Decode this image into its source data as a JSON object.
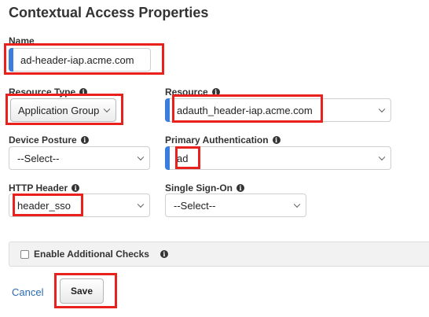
{
  "title": "Contextual Access Properties",
  "name_field": {
    "label": "Name",
    "value": "ad-header-iap.acme.com"
  },
  "resource_type": {
    "label": "Resource Type",
    "value": "Application Group"
  },
  "resource": {
    "label": "Resource",
    "value": "adauth_header-iap.acme.com"
  },
  "device_posture": {
    "label": "Device Posture",
    "value": "--Select--"
  },
  "primary_auth": {
    "label": "Primary Authentication",
    "value": "ad"
  },
  "http_header": {
    "label": "HTTP Header",
    "value": "header_sso"
  },
  "single_sign_on": {
    "label": "Single Sign-On",
    "value": "--Select--"
  },
  "additional_checks": {
    "label": "Enable Additional Checks",
    "checked": false
  },
  "actions": {
    "cancel_label": "Cancel",
    "save_label": "Save"
  },
  "colors": {
    "required_marker": "#3b7ddd",
    "highlight": "#e8211d",
    "link": "#2a6ab4"
  },
  "icons": {
    "info": "info-icon",
    "chevron": "chevron-down-icon"
  }
}
